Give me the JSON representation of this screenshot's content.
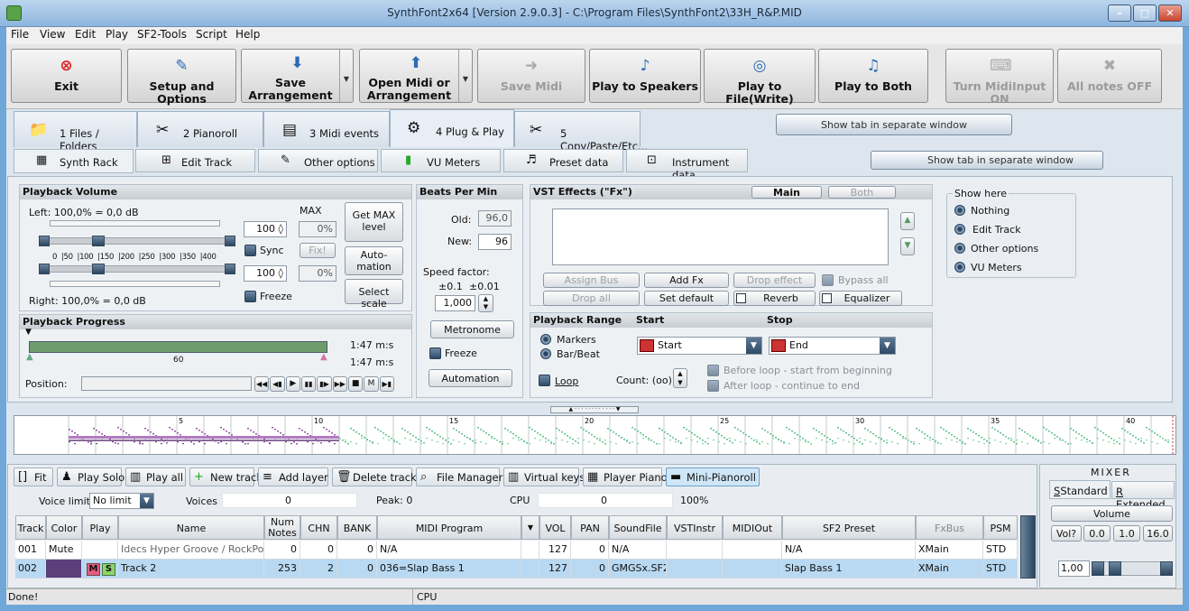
{
  "window": {
    "title": "SynthFont2x64 [Version 2.9.0.3] - C:\\Program Files\\SynthFont2\\33H_R&P.MID"
  },
  "menu": [
    "File",
    "View",
    "Edit",
    "Play",
    "SF2-Tools",
    "Script",
    "Help"
  ],
  "toolbar": {
    "exit": "Exit",
    "setup": "Setup and Options",
    "save_arr_1": "Save",
    "save_arr_2": "Arrangement",
    "open_1": "Open Midi or",
    "open_2": "Arrangement",
    "save_midi": "Save Midi",
    "play_speakers": "Play to Speakers",
    "play_file": "Play to File(Write)",
    "play_both": "Play to Both",
    "turn_midi": "Turn MidiInput ON",
    "all_notes": "All notes OFF"
  },
  "tabs": {
    "files": "1 Files / Folders",
    "pianoroll": "2 Pianoroll",
    "midi_events": "3 Midi events",
    "plug_play": "4 Plug & Play",
    "copy_paste": "5 Copy/Paste/Etc..."
  },
  "show_tab_sep": "Show tab in separate window",
  "subtabs": {
    "synth_rack": "Synth Rack",
    "edit_track": "Edit Track",
    "other_options": "Other options",
    "vu_meters": "VU Meters",
    "preset_data": "Preset data",
    "instrument_data": "Instrument data"
  },
  "show_tab_sep2": "Show tab in separate window",
  "playback_volume": {
    "title": "Playback Volume",
    "left": "Left: 100,0% = 0,0 dB",
    "right": "Right: 100,0% = 0,0 dB",
    "max_label": "MAX",
    "val1": "100",
    "val2": "100",
    "pct1": "0%",
    "pct2": "0%",
    "sync": "Sync",
    "fix": "Fix!",
    "freeze": "Freeze",
    "get_max_1": "Get MAX",
    "get_max_2": "level",
    "automation_1": "Auto-",
    "automation_2": "mation",
    "select_scale": "Select scale",
    "ticks": [
      "0",
      "50",
      "100",
      "150",
      "200",
      "250",
      "300",
      "350",
      "400"
    ]
  },
  "bpm": {
    "title": "Beats Per Min",
    "old_label": "Old:",
    "old_value": "96,0",
    "new_label": "New:",
    "new_value": "96",
    "speed_factor": "Speed factor:",
    "pm1": "±0.1",
    "pm2": "±0.01",
    "speed_value": "1,000",
    "metronome": "Metronome",
    "freeze": "Freeze",
    "automation": "Automation"
  },
  "vst": {
    "title": "VST Effects (\"Fx\")",
    "main_tab": "Main",
    "both_tab": "Both",
    "assign_bus": "Assign Bus",
    "add_fx": "Add Fx",
    "drop_effect": "Drop effect",
    "bypass_all": "Bypass all",
    "drop_all": "Drop all",
    "set_default": "Set default",
    "reverb": "Reverb",
    "equalizer": "Equalizer"
  },
  "show_here": {
    "title": "Show here",
    "options": [
      "Nothing",
      "Edit Track",
      "Other options",
      "VU Meters"
    ]
  },
  "progress": {
    "title": "Playback Progress",
    "time1": "1:47 m:s",
    "time2": "1:47 m:s",
    "tick60": "60",
    "position": "Position:",
    "fill": 1.0
  },
  "range": {
    "title": "Playback Range",
    "start": "Start",
    "stop": "Stop",
    "markers": "Markers",
    "barbeat": "Bar/Beat",
    "start_val": "Start",
    "end_val": "End",
    "loop": "Loop",
    "count": "Count: (oo)",
    "before_loop": "Before loop - start from beginning",
    "after_loop": "After loop - continue to end"
  },
  "overview": {
    "bars": [
      "5",
      "10",
      "15",
      "20",
      "25",
      "30",
      "35",
      "40"
    ]
  },
  "bottom_tools": [
    "Fit",
    "Play Solo",
    "Play all",
    "New track",
    "Add layer",
    "Delete track",
    "File Manager",
    "Virtual keys",
    "Player Piano",
    "Mini-Pianoroll"
  ],
  "stats": {
    "voice_limit": "Voice limit:",
    "no_limit": "No limit",
    "voices": "Voices",
    "voices_val": "0",
    "peak": "Peak: 0",
    "cpu": "CPU",
    "cpu_val": "0",
    "cpu_pct": "100%"
  },
  "table": {
    "headers": [
      "Track",
      "Color",
      "Play",
      "Name",
      "Num Notes",
      "CHN",
      "BANK",
      "MIDI Program",
      "",
      "VOL",
      "PAN",
      "SoundFile",
      "VSTInstr",
      "MIDIOut",
      "SF2 Preset",
      "FxBus",
      "PSM"
    ],
    "rows": [
      {
        "track": "001",
        "color": "Mute",
        "play": "",
        "name": "Idecs Hyper Groove / RockPop",
        "notes": "0",
        "chn": "0",
        "bank": "0",
        "program": "N/A",
        "vol": "127",
        "pan": "0",
        "soundfile": "N/A",
        "vst": "",
        "midiout": "",
        "preset": "N/A",
        "fxbus": "XMain",
        "psm": "STD"
      },
      {
        "track": "002",
        "color": "",
        "play": "M S",
        "name": "Track 2",
        "notes": "253",
        "chn": "2",
        "bank": "0",
        "program": "036=Slap Bass 1",
        "vol": "127",
        "pan": "0",
        "soundfile": "GMGSx.SF2",
        "vst": "",
        "midiout": "",
        "preset": "Slap Bass 1",
        "fxbus": "XMain",
        "psm": "STD"
      }
    ]
  },
  "mixer": {
    "title": "MIXER",
    "standard": "Standard",
    "extended": "Extended",
    "volume": "Volume",
    "b1": "Vol?",
    "b2": "0.0",
    "b3": "1.0",
    "b4": "16.0",
    "value": "1,00"
  },
  "status": {
    "left": "Done!",
    "cpu": "CPU"
  }
}
